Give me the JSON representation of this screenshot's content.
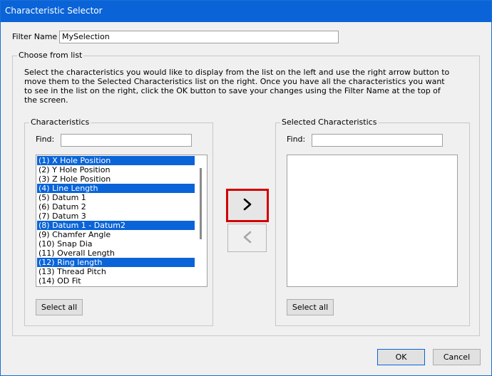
{
  "window": {
    "title": "Characteristic Selector"
  },
  "filter": {
    "label": "Filter Name",
    "value": "MySelection"
  },
  "choose_group": {
    "label": "Choose from list",
    "description": "Select the characteristics you would like to display from the list on the left and use the right arrow button to move them to the Selected Characteristics list on the right. Once you have all the characteristics you want to see in the list on the right, click the OK button to save your changes using the Filter Name at the top of the screen."
  },
  "characteristics": {
    "label": "Characteristics",
    "find_label": "Find:",
    "find_value": "",
    "items": [
      {
        "label": "(1) X Hole Position",
        "selected": true
      },
      {
        "label": "(2) Y Hole Position",
        "selected": false
      },
      {
        "label": "(3) Z Hole Position",
        "selected": false
      },
      {
        "label": "(4) Line Length",
        "selected": true
      },
      {
        "label": "(5) Datum 1",
        "selected": false
      },
      {
        "label": "(6) Datum 2",
        "selected": false
      },
      {
        "label": "(7) Datum 3",
        "selected": false
      },
      {
        "label": "(8) Datum 1 - Datum2",
        "selected": true
      },
      {
        "label": "(9) Chamfer Angle",
        "selected": false
      },
      {
        "label": "(10) Snap Dia",
        "selected": false
      },
      {
        "label": "(11) Overall Length",
        "selected": false
      },
      {
        "label": "(12) Ring length",
        "selected": true
      },
      {
        "label": "(13) Thread Pitch",
        "selected": false
      },
      {
        "label": "(14) OD Fit",
        "selected": false
      }
    ],
    "select_all_label": "Select all"
  },
  "selected_characteristics": {
    "label": "Selected Characteristics",
    "find_label": "Find:",
    "find_value": "",
    "items": [],
    "select_all_label": "Select all"
  },
  "arrows": {
    "move_right_icon": "chevron-right-icon",
    "move_left_icon": "chevron-left-icon",
    "highlight_color": "#d00000"
  },
  "buttons": {
    "ok": "OK",
    "cancel": "Cancel"
  },
  "colors": {
    "title_bar": "#0a64d8",
    "selection": "#0a64d8"
  }
}
